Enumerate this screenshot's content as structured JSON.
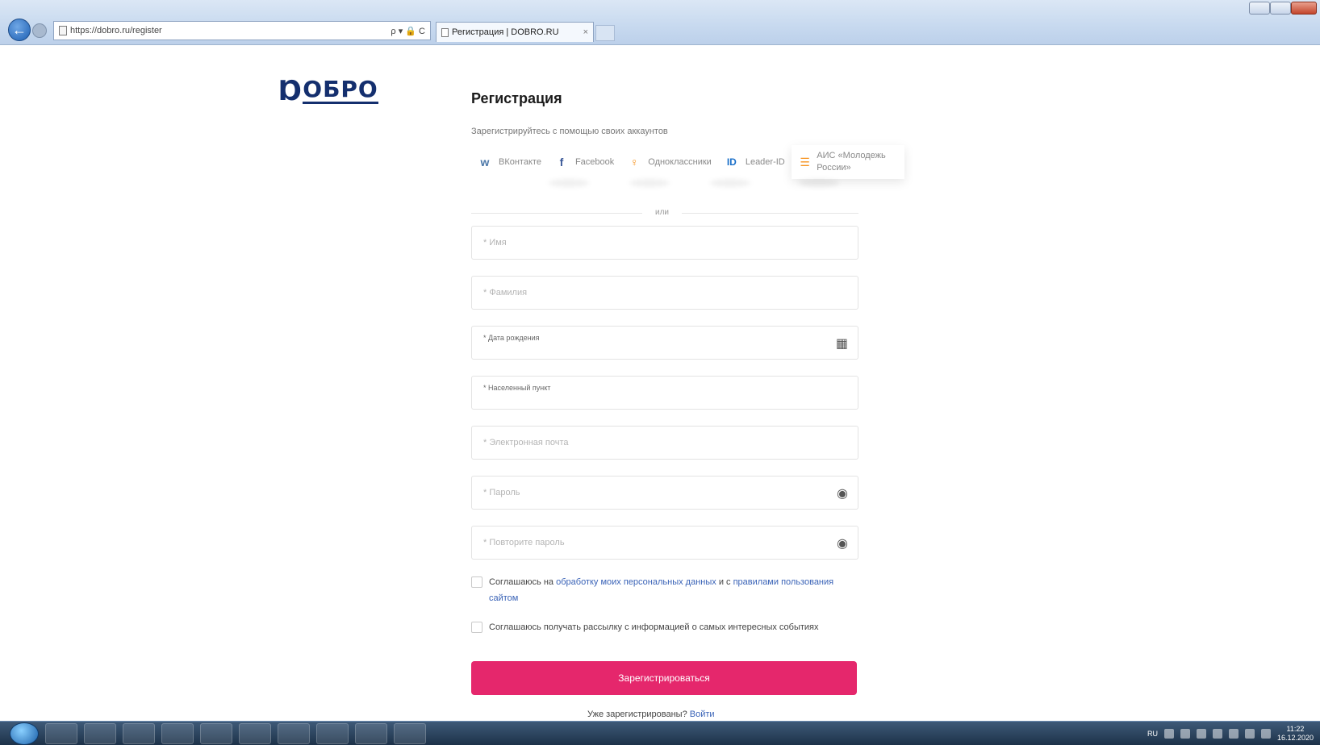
{
  "browser": {
    "url": "https://dobro.ru/register",
    "tab_title": "Регистрация | DOBRO.RU",
    "tab_close": "×",
    "addr_controls": "ρ ▾ 🔒 C",
    "back_glyph": "←"
  },
  "logo": {
    "mark": "Ɒ",
    "word": "ОБРО"
  },
  "page": {
    "title": "Регистрация",
    "subtitle": "Зарегистрируйтесь с помощью своих аккаунтов",
    "divider": "или"
  },
  "social": [
    {
      "icon": "vk-icon",
      "glyph": "w",
      "label": "ВКонтакте",
      "color": "#4a76a8"
    },
    {
      "icon": "facebook-icon",
      "glyph": "f",
      "label": "Facebook",
      "color": "#3b5998"
    },
    {
      "icon": "odnoklassniki-icon",
      "glyph": "♀",
      "label": "Одноклассники",
      "color": "#f7931e"
    },
    {
      "icon": "leader-id-icon",
      "glyph": "ID",
      "label": "Leader-ID",
      "color": "#1a6fc9"
    },
    {
      "icon": "ams-icon",
      "glyph": "☰",
      "label": "АИС «Молодежь России»",
      "color": "#f7931e"
    }
  ],
  "fields": {
    "name": "* Имя",
    "surname": "* Фамилия",
    "birthdate": "* Дата рождения",
    "city": "* Населенный пункт",
    "email": "* Электронная почта",
    "password": "* Пароль",
    "password_repeat": "* Повторите пароль"
  },
  "consent": {
    "personal_prefix": "Соглашаюсь на ",
    "personal_link1": "обработку моих персональных данных",
    "personal_mid": " и с ",
    "personal_link2": "правилами пользования сайтом",
    "newsletter": "Соглашаюсь получать рассылку с информацией о самых интересных событиях"
  },
  "submit": "Зарегистрироваться",
  "already": {
    "text": "Уже зарегистрированы? ",
    "link": "Войти"
  },
  "taskbar": {
    "lang": "RU",
    "time": "11:22",
    "date": "16.12.2020"
  }
}
